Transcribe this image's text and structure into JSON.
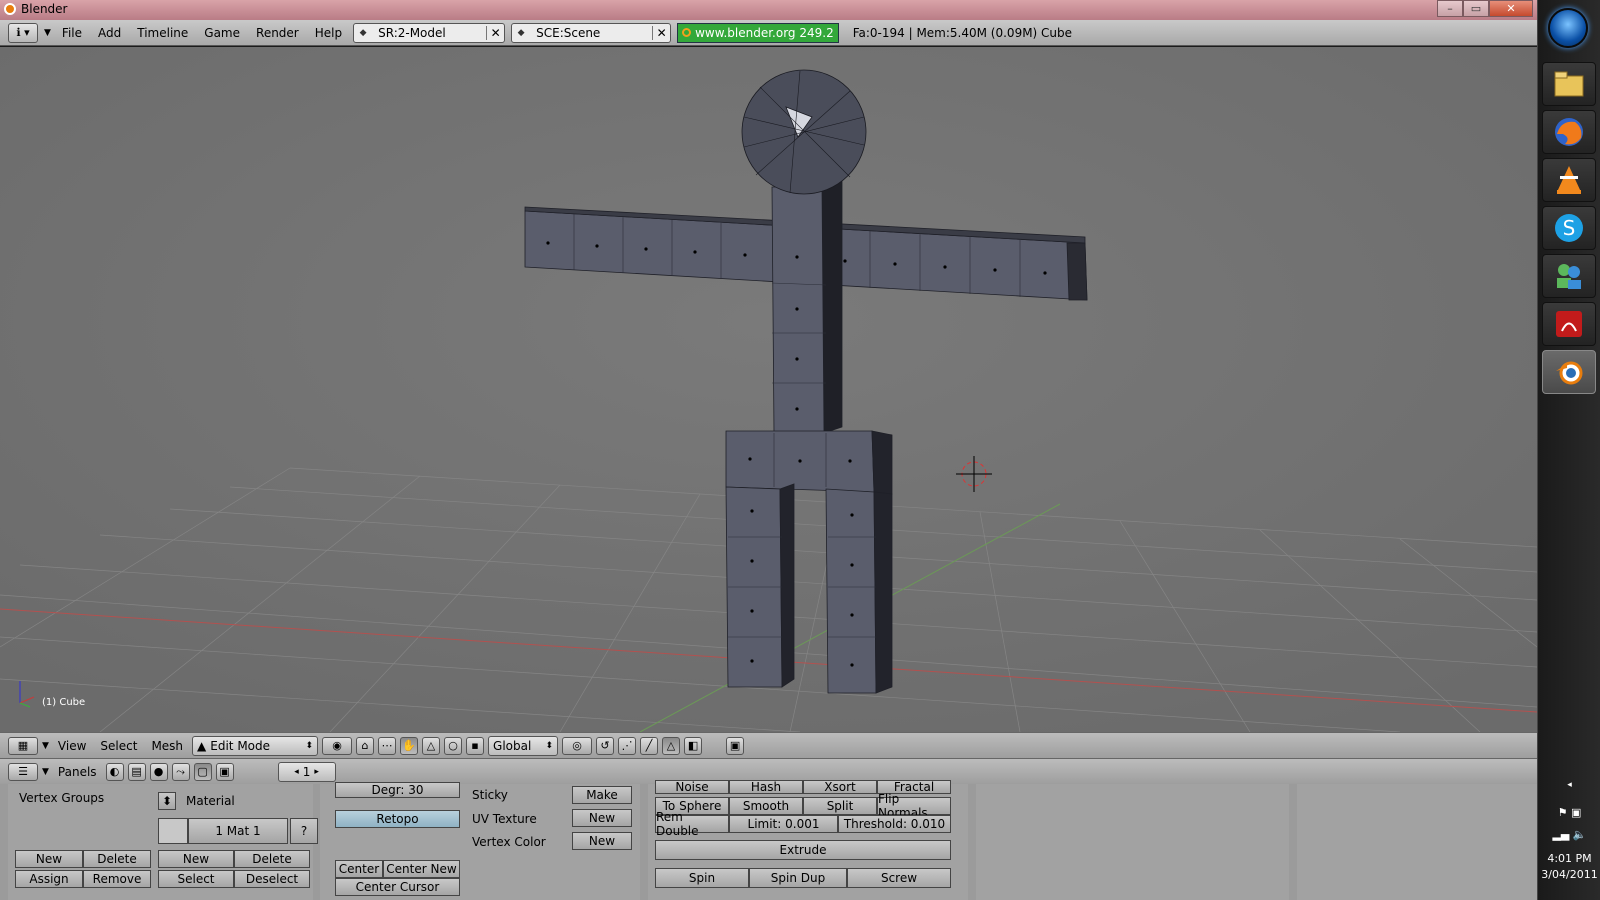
{
  "window": {
    "title": "Blender",
    "controls": [
      "–",
      "▭",
      "✕"
    ]
  },
  "infobar": {
    "menus": [
      "File",
      "Add",
      "Timeline",
      "Game",
      "Render",
      "Help"
    ],
    "screen": "SR:2-Model",
    "scene": "SCE:Scene",
    "url": "www.blender.org 249.2",
    "stats": "Fa:0-194 | Mem:5.40M (0.09M) Cube"
  },
  "viewport": {
    "object_label": "(1) Cube"
  },
  "header3d": {
    "menus": [
      "View",
      "Select",
      "Mesh"
    ],
    "mode": "Edit Mode",
    "orientation": "Global"
  },
  "buttons_header": {
    "label": "Panels",
    "frame": "1"
  },
  "panels": {
    "vertex_groups": {
      "title": "Vertex Groups",
      "new": "New",
      "delete": "Delete",
      "assign": "Assign",
      "remove": "Remove"
    },
    "material": {
      "title": "Material",
      "mat": "1 Mat 1",
      "help": "?",
      "new": "New",
      "delete": "Delete",
      "select": "Select",
      "deselect": "Deselect"
    },
    "mesh": {
      "degr": "Degr: 30",
      "retopo": "Retopo",
      "center": "Center",
      "center_new": "Center New",
      "center_cursor": "Center Cursor",
      "sticky": "Sticky",
      "make": "Make",
      "uv_texture": "UV Texture",
      "uv_new": "New",
      "vertex_color": "Vertex Color",
      "vc_new": "New"
    },
    "tools": {
      "noise": "Noise",
      "hash": "Hash",
      "xsort": "Xsort",
      "fractal": "Fractal",
      "to_sphere": "To Sphere",
      "smooth": "Smooth",
      "split": "Split",
      "flip_normals": "Flip Normals",
      "rem_double": "Rem Double",
      "limit": "Limit: 0.001",
      "threshold": "Threshold: 0.010",
      "extrude": "Extrude",
      "spin": "Spin",
      "spin_dup": "Spin Dup",
      "screw": "Screw"
    }
  },
  "taskbar": {
    "apps": [
      "explorer-icon",
      "firefox-icon",
      "vlc-icon",
      "skype-icon",
      "messenger-icon",
      "acrobat-icon",
      "blender-icon"
    ],
    "time": "4:01 PM",
    "date": "3/04/2011"
  }
}
